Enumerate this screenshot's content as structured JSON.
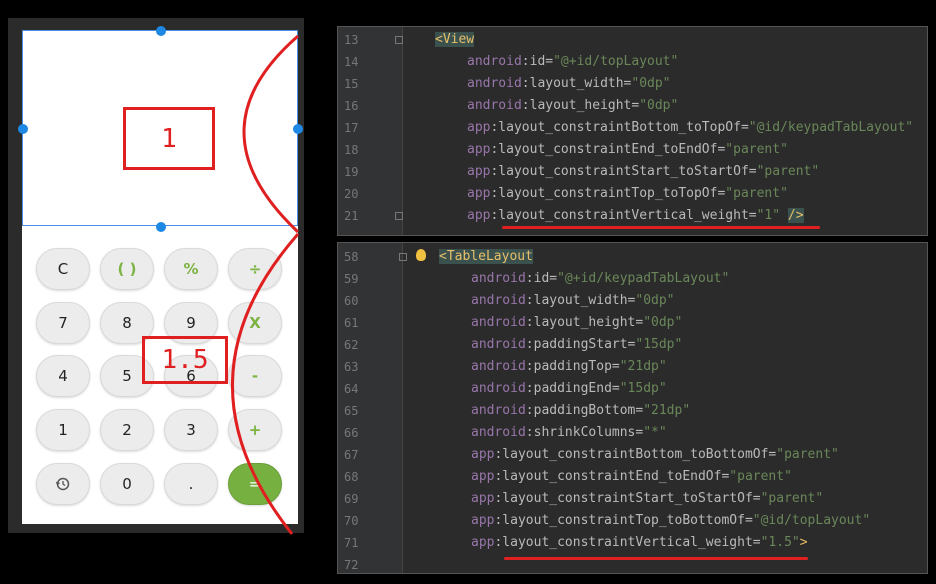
{
  "preview": {
    "top_ratio_label": "1",
    "bottom_ratio_label": "1.5",
    "keypad": [
      {
        "label": "C",
        "style": "normal"
      },
      {
        "label": "( )",
        "style": "green"
      },
      {
        "label": "%",
        "style": "green"
      },
      {
        "label": "÷",
        "style": "green"
      },
      {
        "label": "7",
        "style": "normal"
      },
      {
        "label": "8",
        "style": "normal"
      },
      {
        "label": "9",
        "style": "normal"
      },
      {
        "label": "X",
        "style": "green"
      },
      {
        "label": "4",
        "style": "normal"
      },
      {
        "label": "5",
        "style": "normal"
      },
      {
        "label": "6",
        "style": "normal"
      },
      {
        "label": "-",
        "style": "green"
      },
      {
        "label": "1",
        "style": "normal"
      },
      {
        "label": "2",
        "style": "normal"
      },
      {
        "label": "3",
        "style": "normal"
      },
      {
        "label": "+",
        "style": "green"
      },
      {
        "label": "history-icon",
        "style": "normal"
      },
      {
        "label": "0",
        "style": "normal"
      },
      {
        "label": ".",
        "style": "normal"
      },
      {
        "label": "=",
        "style": "eq"
      }
    ]
  },
  "code_top": {
    "lines": [
      {
        "num": "13",
        "parts": [
          [
            "tag",
            "<View"
          ]
        ]
      },
      {
        "num": "14",
        "parts": [
          [
            "ns-android",
            "android"
          ],
          [
            "attr",
            ":id="
          ],
          [
            "val",
            "\"@+id/topLayout\""
          ]
        ]
      },
      {
        "num": "15",
        "parts": [
          [
            "ns-android",
            "android"
          ],
          [
            "attr",
            ":layout_width="
          ],
          [
            "val",
            "\"0dp\""
          ]
        ]
      },
      {
        "num": "16",
        "parts": [
          [
            "ns-android",
            "android"
          ],
          [
            "attr",
            ":layout_height="
          ],
          [
            "val",
            "\"0dp\""
          ]
        ]
      },
      {
        "num": "17",
        "parts": [
          [
            "ns-app",
            "app"
          ],
          [
            "attr",
            ":layout_constraintBottom_toTopOf="
          ],
          [
            "val",
            "\"@id/keypadTabLayout\""
          ]
        ]
      },
      {
        "num": "18",
        "parts": [
          [
            "ns-app",
            "app"
          ],
          [
            "attr",
            ":layout_constraintEnd_toEndOf="
          ],
          [
            "val",
            "\"parent\""
          ]
        ]
      },
      {
        "num": "19",
        "parts": [
          [
            "ns-app",
            "app"
          ],
          [
            "attr",
            ":layout_constraintStart_toStartOf="
          ],
          [
            "val",
            "\"parent\""
          ]
        ]
      },
      {
        "num": "20",
        "parts": [
          [
            "ns-app",
            "app"
          ],
          [
            "attr",
            ":layout_constraintTop_toTopOf="
          ],
          [
            "val",
            "\"parent\""
          ]
        ]
      },
      {
        "num": "21",
        "parts": [
          [
            "ns-app",
            "app"
          ],
          [
            "attr",
            ":layout_constraintVertical_weight="
          ],
          [
            "val",
            "\"1\""
          ],
          [
            "attr",
            " "
          ],
          [
            "tag",
            "/>"
          ]
        ]
      }
    ]
  },
  "code_bottom": {
    "lines": [
      {
        "num": "58",
        "parts": [
          [
            "tag",
            "<TableLayout"
          ]
        ]
      },
      {
        "num": "59",
        "parts": [
          [
            "ns-android",
            "android"
          ],
          [
            "attr",
            ":id="
          ],
          [
            "val",
            "\"@+id/keypadTabLayout\""
          ]
        ]
      },
      {
        "num": "60",
        "parts": [
          [
            "ns-android",
            "android"
          ],
          [
            "attr",
            ":layout_width="
          ],
          [
            "val",
            "\"0dp\""
          ]
        ]
      },
      {
        "num": "61",
        "parts": [
          [
            "ns-android",
            "android"
          ],
          [
            "attr",
            ":layout_height="
          ],
          [
            "val",
            "\"0dp\""
          ]
        ]
      },
      {
        "num": "62",
        "parts": [
          [
            "ns-android",
            "android"
          ],
          [
            "attr",
            ":paddingStart="
          ],
          [
            "val",
            "\"15dp\""
          ]
        ]
      },
      {
        "num": "63",
        "parts": [
          [
            "ns-android",
            "android"
          ],
          [
            "attr",
            ":paddingTop="
          ],
          [
            "val",
            "\"21dp\""
          ]
        ]
      },
      {
        "num": "64",
        "parts": [
          [
            "ns-android",
            "android"
          ],
          [
            "attr",
            ":paddingEnd="
          ],
          [
            "val",
            "\"15dp\""
          ]
        ]
      },
      {
        "num": "65",
        "parts": [
          [
            "ns-android",
            "android"
          ],
          [
            "attr",
            ":paddingBottom="
          ],
          [
            "val",
            "\"21dp\""
          ]
        ]
      },
      {
        "num": "66",
        "parts": [
          [
            "ns-android",
            "android"
          ],
          [
            "attr",
            ":shrinkColumns="
          ],
          [
            "val",
            "\"*\""
          ]
        ]
      },
      {
        "num": "67",
        "parts": [
          [
            "ns-app",
            "app"
          ],
          [
            "attr",
            ":layout_constraintBottom_toBottomOf="
          ],
          [
            "val",
            "\"parent\""
          ]
        ]
      },
      {
        "num": "68",
        "parts": [
          [
            "ns-app",
            "app"
          ],
          [
            "attr",
            ":layout_constraintEnd_toEndOf="
          ],
          [
            "val",
            "\"parent\""
          ]
        ]
      },
      {
        "num": "69",
        "parts": [
          [
            "ns-app",
            "app"
          ],
          [
            "attr",
            ":layout_constraintStart_toStartOf="
          ],
          [
            "val",
            "\"parent\""
          ]
        ]
      },
      {
        "num": "70",
        "parts": [
          [
            "ns-app",
            "app"
          ],
          [
            "attr",
            ":layout_constraintTop_toBottomOf="
          ],
          [
            "val",
            "\"@id/topLayout\""
          ]
        ]
      },
      {
        "num": "71",
        "parts": [
          [
            "ns-app",
            "app"
          ],
          [
            "attr",
            ":layout_constraintVertical_weight="
          ],
          [
            "val",
            "\"1.5\""
          ],
          [
            "tag",
            ">"
          ]
        ]
      },
      {
        "num": "72",
        "parts": []
      }
    ]
  },
  "colors": {
    "annotation_red": "#e02020",
    "equals_key_green": "#76b041",
    "operator_green": "#7cb342",
    "editor_bg": "#2b2b2b"
  }
}
